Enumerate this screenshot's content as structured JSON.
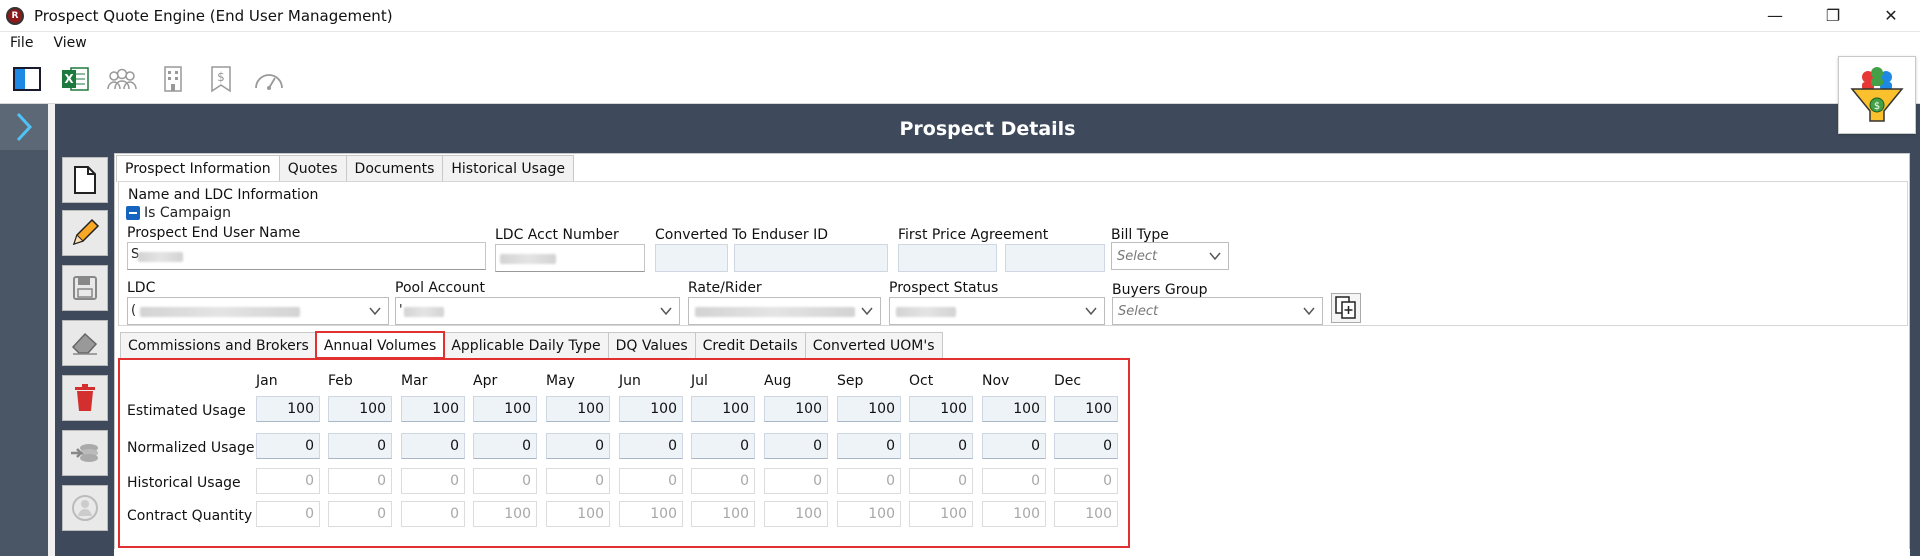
{
  "window": {
    "title": "Prospect Quote Engine (End User Management)",
    "minimize_glyph": "—",
    "maximize_glyph": "❐",
    "close_glyph": "✕"
  },
  "menu": {
    "file": "File",
    "view": "View"
  },
  "toolbar": {
    "icons": [
      "layout-panel-icon",
      "excel-icon",
      "users-group-icon",
      "building-icon",
      "dollar-bookmark-icon",
      "speedometer-icon"
    ],
    "excel_letter": "X"
  },
  "header": {
    "title": "Prospect Details"
  },
  "vertical_tools": [
    "new-document-icon",
    "edit-pencil-icon",
    "save-disk-icon",
    "eraser-icon",
    "delete-trash-icon",
    "convert-coins-icon",
    "disabled-circle-icon"
  ],
  "top_tabs": [
    {
      "label": "Prospect Information",
      "active": true
    },
    {
      "label": "Quotes",
      "active": false
    },
    {
      "label": "Documents",
      "active": false
    },
    {
      "label": "Historical Usage",
      "active": false
    }
  ],
  "name_ldc": {
    "section_title": "Name and LDC Information",
    "is_campaign_label": "Is Campaign",
    "prospect_end_user_name_label": "Prospect End User Name",
    "prospect_end_user_name_value": "S",
    "ldc_acct_number_label": "LDC Acct Number",
    "converted_to_enduser_id_label": "Converted To Enduser ID",
    "first_price_agreement_label": "First Price Agreement",
    "bill_type_label": "Bill Type",
    "bill_type_placeholder": "Select",
    "ldc_label": "LDC",
    "ldc_value": "(",
    "pool_account_label": "Pool Account",
    "pool_account_value": "'",
    "rate_rider_label": "Rate/Rider",
    "prospect_status_label": "Prospect Status",
    "buyers_group_label": "Buyers Group",
    "buyers_group_placeholder": "Select"
  },
  "sub_tabs": [
    {
      "label": "Commissions and Brokers",
      "active": false
    },
    {
      "label": "Annual Volumes",
      "active": true
    },
    {
      "label": "Applicable Daily Type",
      "active": false
    },
    {
      "label": "DQ Values",
      "active": false
    },
    {
      "label": "Credit Details",
      "active": false
    },
    {
      "label": "Converted UOM's",
      "active": false
    }
  ],
  "annual_volumes": {
    "months": [
      "Jan",
      "Feb",
      "Mar",
      "Apr",
      "May",
      "Jun",
      "Jul",
      "Aug",
      "Sep",
      "Oct",
      "Nov",
      "Dec"
    ],
    "rows": [
      {
        "label": "Estimated Usage",
        "values": [
          "100",
          "100",
          "100",
          "100",
          "100",
          "100",
          "100",
          "100",
          "100",
          "100",
          "100",
          "100"
        ],
        "editable": true
      },
      {
        "label": "Normalized Usage",
        "values": [
          "0",
          "0",
          "0",
          "0",
          "0",
          "0",
          "0",
          "0",
          "0",
          "0",
          "0",
          "0"
        ],
        "editable": true
      },
      {
        "label": "Historical Usage",
        "values": [
          "0",
          "0",
          "0",
          "0",
          "0",
          "0",
          "0",
          "0",
          "0",
          "0",
          "0",
          "0"
        ],
        "editable": false
      },
      {
        "label": "Contract Quantity",
        "values": [
          "0",
          "0",
          "0",
          "100",
          "100",
          "100",
          "100",
          "100",
          "100",
          "100",
          "100",
          "100"
        ],
        "editable": false
      }
    ]
  },
  "colors": {
    "header_bg": "#3e4a5c",
    "left_strip": "#4a5566",
    "highlight_red": "#e03030",
    "checkbox_blue": "#1565c0",
    "readonly_field": "#eef3f8"
  }
}
